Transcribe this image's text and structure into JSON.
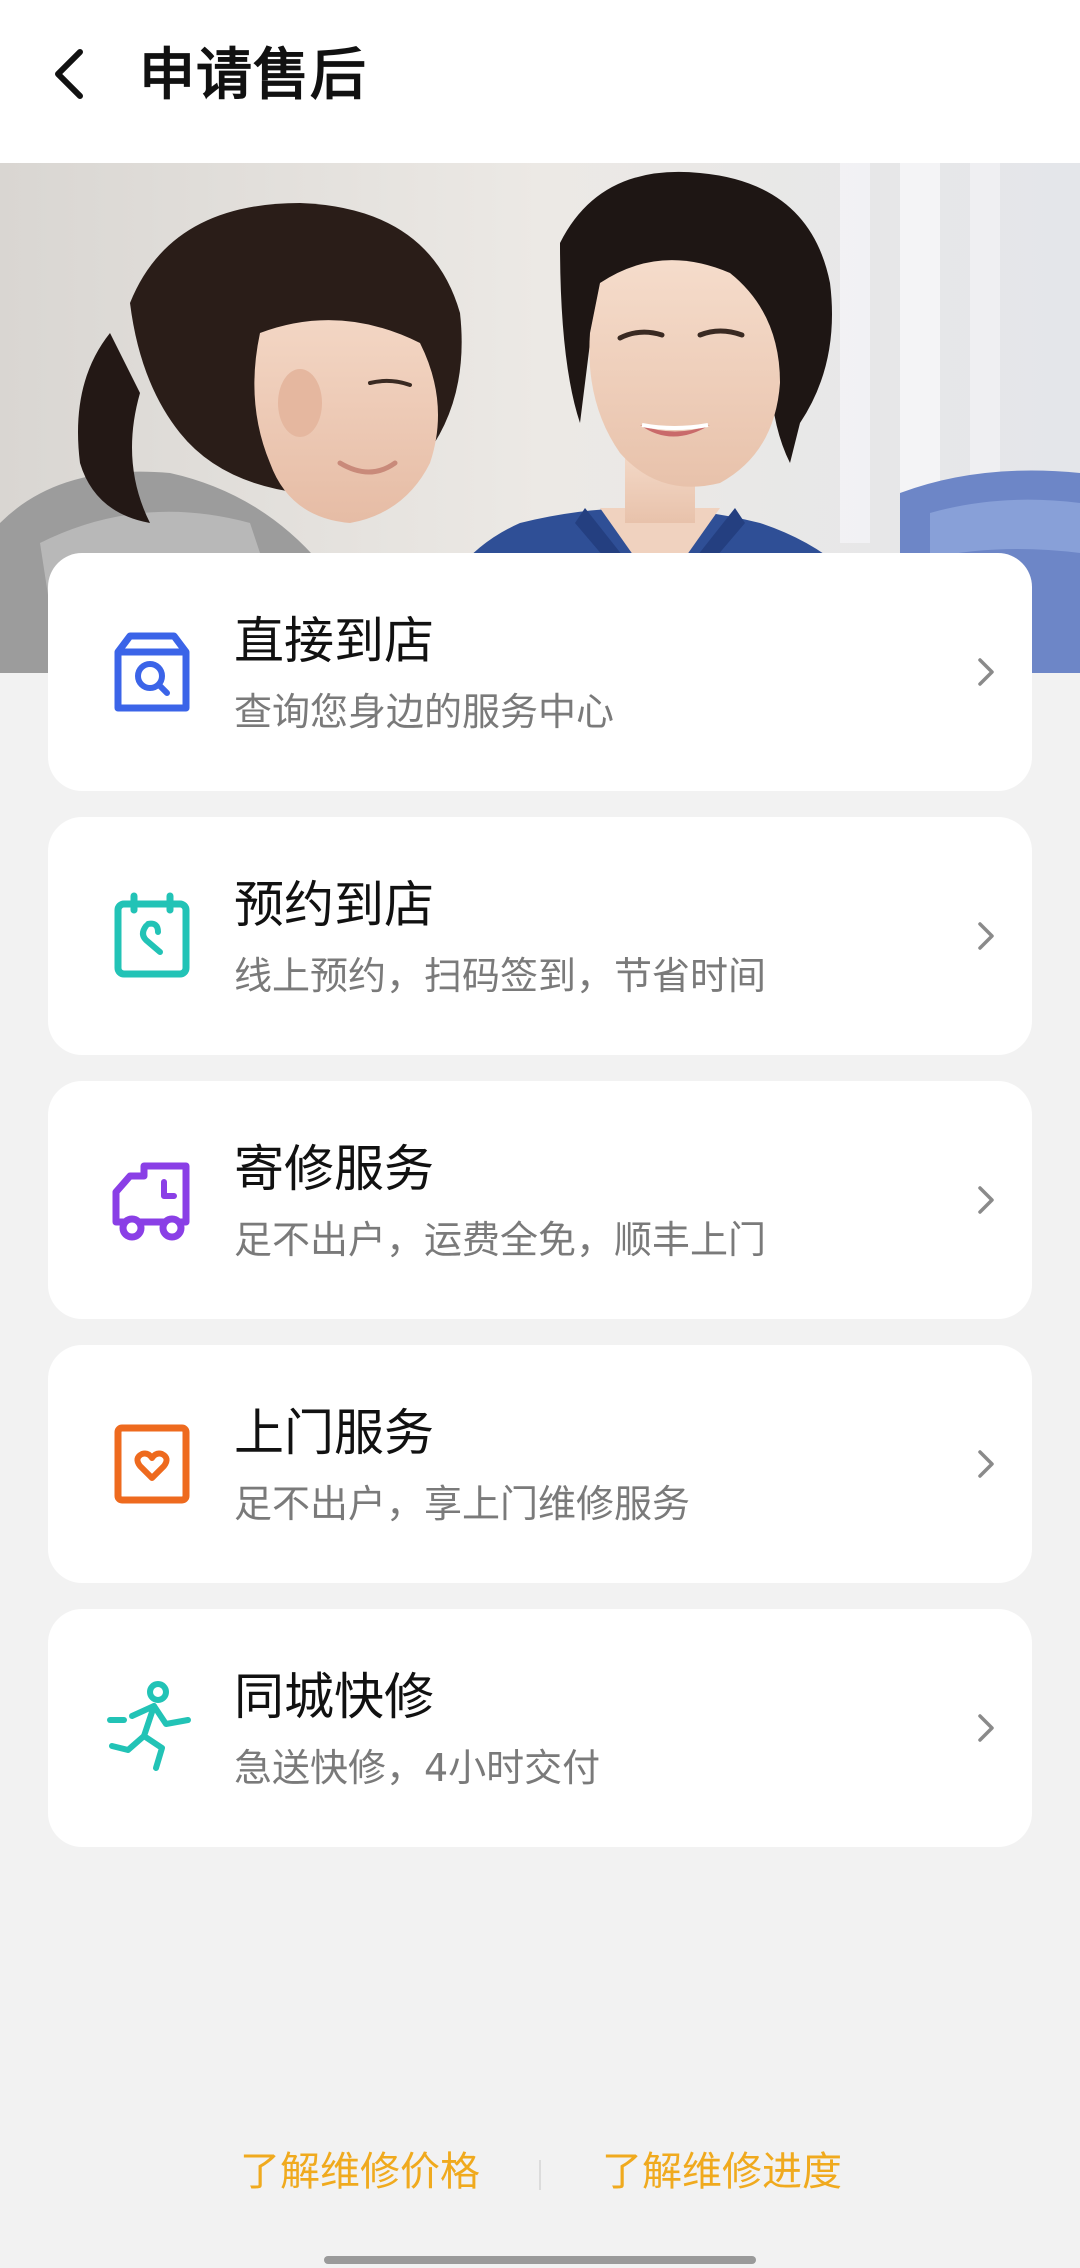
{
  "header": {
    "title": "申请售后",
    "back_icon": "chevron-left-icon"
  },
  "banner": {
    "image": "customer-service-photo"
  },
  "services": [
    {
      "title": "直接到店",
      "subtitle": "查询您身边的服务中心",
      "icon": "store-search-icon",
      "color": "#3b64e8"
    },
    {
      "title": "预约到店",
      "subtitle": "线上预约，扫码签到，节省时间",
      "icon": "calendar-wrench-icon",
      "color": "#22c3b6"
    },
    {
      "title": "寄修服务",
      "subtitle": "足不出户，运费全免，顺丰上门",
      "icon": "delivery-truck-icon",
      "color": "#8a3fe6"
    },
    {
      "title": "上门服务",
      "subtitle": "足不出户，享上门维修服务",
      "icon": "home-heart-icon",
      "color": "#ee6a1e"
    },
    {
      "title": "同城快修",
      "subtitle": "急送快修，4小时交付",
      "icon": "running-person-icon",
      "color": "#22c3b6"
    }
  ],
  "footer": {
    "price_link": "了解维修价格",
    "progress_link": "了解维修进度",
    "link_color": "#f0aa1e"
  }
}
